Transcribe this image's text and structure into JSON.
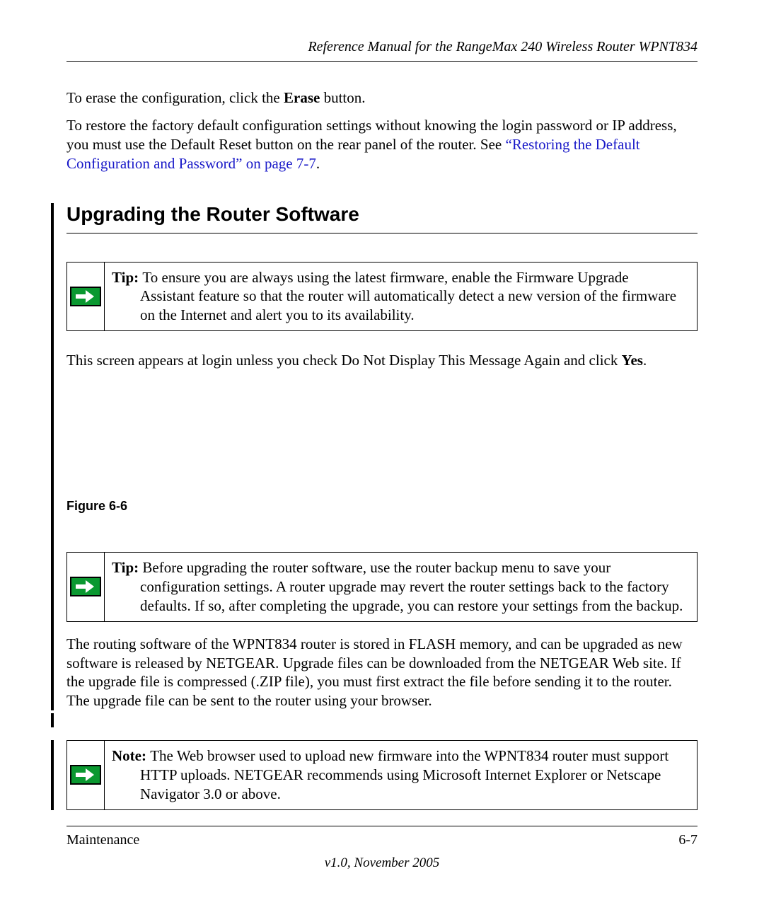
{
  "header": {
    "running_title": "Reference Manual for the RangeMax 240 Wireless Router WPNT834"
  },
  "para1": {
    "pre": "To erase the configuration, click the ",
    "bold": "Erase",
    "post": " button."
  },
  "para2": {
    "pre": "To restore the factory default configuration settings without knowing the login password or IP address, you must use the Default Reset button on the rear panel of the router. See ",
    "link": "“Restoring the Default Configuration and Password” on page 7-7",
    "post": "."
  },
  "section": {
    "heading": "Upgrading the Router Software"
  },
  "tip1": {
    "lead": "Tip: ",
    "text": "To ensure you are always using the latest firmware, enable the Firmware Upgrade Assistant feature so that the router will automatically detect a new version of the firmware on the Internet and alert you to its availability."
  },
  "para3": {
    "pre": "This screen appears at login unless you check Do Not Display This Message Again and click ",
    "bold": "Yes",
    "post": "."
  },
  "figure": {
    "caption": "Figure 6-6"
  },
  "tip2": {
    "lead": "Tip: ",
    "text": "Before upgrading the router software, use the router backup menu to save your configuration settings. A router upgrade may revert the router settings back to the factory defaults. If so, after completing the upgrade, you can restore your settings from the backup."
  },
  "para4": "The routing software of the WPNT834 router is stored in FLASH memory, and can be upgraded as new software is released by NETGEAR. Upgrade files can be downloaded from the NETGEAR Web site. If the upgrade file is compressed (.ZIP file), you must first extract the file before sending it to the router. The upgrade file can be sent to the router using your browser.",
  "note": {
    "lead": "Note: ",
    "text": "The Web browser used to upload new firmware into the WPNT834 router must support HTTP uploads. NETGEAR recommends using Microsoft Internet Explorer or Netscape Navigator 3.0 or above."
  },
  "footer": {
    "left": "Maintenance",
    "right": "6-7",
    "center": "v1.0, November 2005"
  }
}
